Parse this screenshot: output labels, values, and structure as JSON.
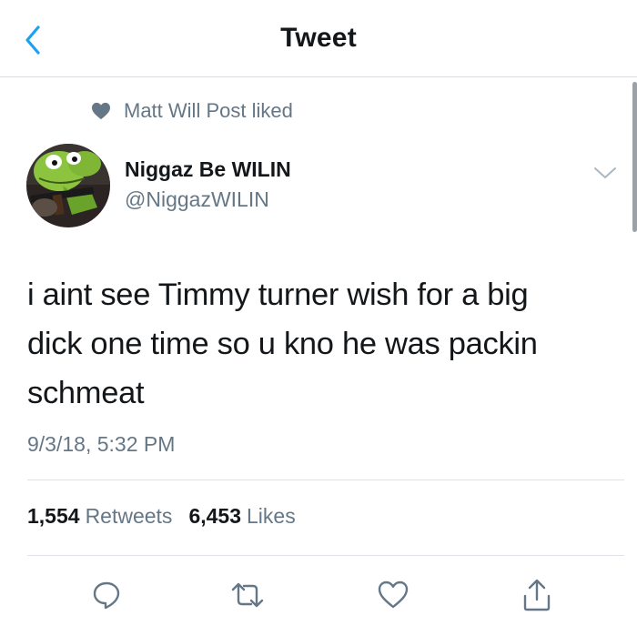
{
  "header": {
    "title": "Tweet",
    "back_icon": "chevron-left-icon"
  },
  "social_context": {
    "icon": "heart-filled-icon",
    "text": "Matt Will Post liked"
  },
  "author": {
    "name": "Niggaz Be WILIN",
    "handle": "@NiggazWILIN",
    "avatar_icon": "avatar"
  },
  "tweet": {
    "text": "i aint see Timmy turner wish for a big\ndick one time so u kno he was packin\nschmeat",
    "timestamp": "9/3/18, 5:32 PM"
  },
  "stats": {
    "retweets_count": "1,554",
    "retweets_label": "Retweets",
    "likes_count": "6,453",
    "likes_label": "Likes"
  },
  "actions": [
    {
      "name": "reply",
      "icon": "reply-icon"
    },
    {
      "name": "retweet",
      "icon": "retweet-icon"
    },
    {
      "name": "like",
      "icon": "heart-outline-icon"
    },
    {
      "name": "share",
      "icon": "share-icon"
    }
  ],
  "colors": {
    "accent": "#1da1f2",
    "text_primary": "#14171a",
    "text_secondary": "#657786",
    "divider": "#dfe3e7"
  }
}
